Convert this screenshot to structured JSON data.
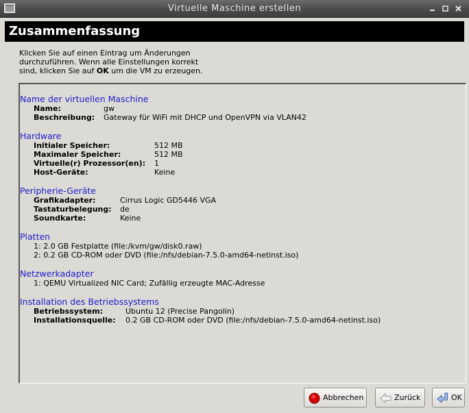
{
  "window": {
    "title": "Virtuelle Maschine erstellen"
  },
  "header": {
    "title": "Zusammenfassung"
  },
  "instructions": {
    "line1": "Klicken Sie auf einen Eintrag um Änderungen",
    "line2": "durchzuführen. Wenn alle Einstellungen korrekt",
    "line3_pre": "sind, klicken Sie auf ",
    "line3_bold": "OK",
    "line3_post": " um die VM zu erzeugen."
  },
  "summary": {
    "vm_name": {
      "title": "Name der virtuellen Maschine",
      "name_label": "Name:",
      "name_value": "gw",
      "desc_label": "Beschreibung:",
      "desc_value": "Gateway für WiFi mit DHCP und OpenVPN via VLAN42"
    },
    "hardware": {
      "title": "Hardware",
      "initial_mem_label": "Initialer Speicher:",
      "initial_mem_value": "512 MB",
      "max_mem_label": "Maximaler Speicher:",
      "max_mem_value": "512 MB",
      "cpus_label": "Virtuelle(r) Prozessor(en):",
      "cpus_value": "1",
      "host_devices_label": "Host-Geräte:",
      "host_devices_value": "Keine"
    },
    "peripherals": {
      "title": "Peripherie-Geräte",
      "graphics_label": "Grafikadapter:",
      "graphics_value": "Cirrus Logic GD5446 VGA",
      "keyboard_label": "Tastaturbelegung:",
      "keyboard_value": "de",
      "sound_label": "Soundkarte:",
      "sound_value": "Keine"
    },
    "disks": {
      "title": "Platten",
      "items": [
        "1: 2.0 GB Festplatte (file:/kvm/gw/disk0.raw)",
        "2: 0.2 GB CD-ROM oder DVD (file:/nfs/debian-7.5.0-amd64-netinst.iso)"
      ]
    },
    "network": {
      "title": "Netzwerkadapter",
      "items": [
        "1: QEMU Virtualized NIC Card; Zufällig erzeugte MAC-Adresse"
      ]
    },
    "os_install": {
      "title": "Installation des Betriebssystems",
      "os_label": "Betriebssystem:",
      "os_value": "Ubuntu 12 (Precise Pangolin)",
      "source_label": "Installationsquelle:",
      "source_value": "0.2 GB CD-ROM oder DVD (file:/nfs/debian-7.5.0-amd64-netinst.iso)"
    }
  },
  "buttons": {
    "cancel": "Abbrechen",
    "back": "Zurück",
    "ok": "OK"
  },
  "colors": {
    "section_title": "#1c1ccc",
    "header_bg": "#000000",
    "window_bg": "#dcdad5"
  }
}
